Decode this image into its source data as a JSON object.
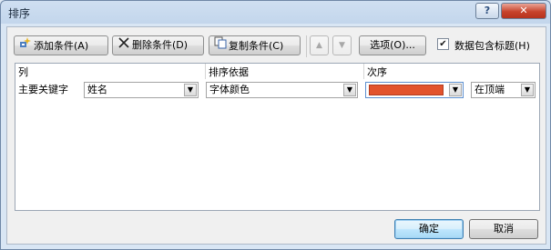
{
  "window": {
    "title": "排序",
    "help_label": "?",
    "close_label": "✕"
  },
  "toolbar": {
    "add_label": "添加条件(A)",
    "delete_label": "删除条件(D)",
    "copy_label": "复制条件(C)",
    "move_up_label": "▲",
    "move_down_label": "▼",
    "options_label": "选项(O)...",
    "header_checkbox_label": "数据包含标题(H)",
    "header_checkbox_checked": true
  },
  "grid": {
    "columns": [
      "列",
      "排序依据",
      "次序"
    ],
    "rows": [
      {
        "label": "主要关键字",
        "column_value": "姓名",
        "sort_on_value": "字体颜色",
        "order_color": "#e2532d",
        "position_value": "在顶端"
      }
    ]
  },
  "footer": {
    "ok_label": "确定",
    "cancel_label": "取消"
  },
  "icons": {
    "add": "add-condition-icon",
    "delete": "delete-icon",
    "copy": "copy-icon",
    "dropdown": "chevron-down-icon"
  }
}
